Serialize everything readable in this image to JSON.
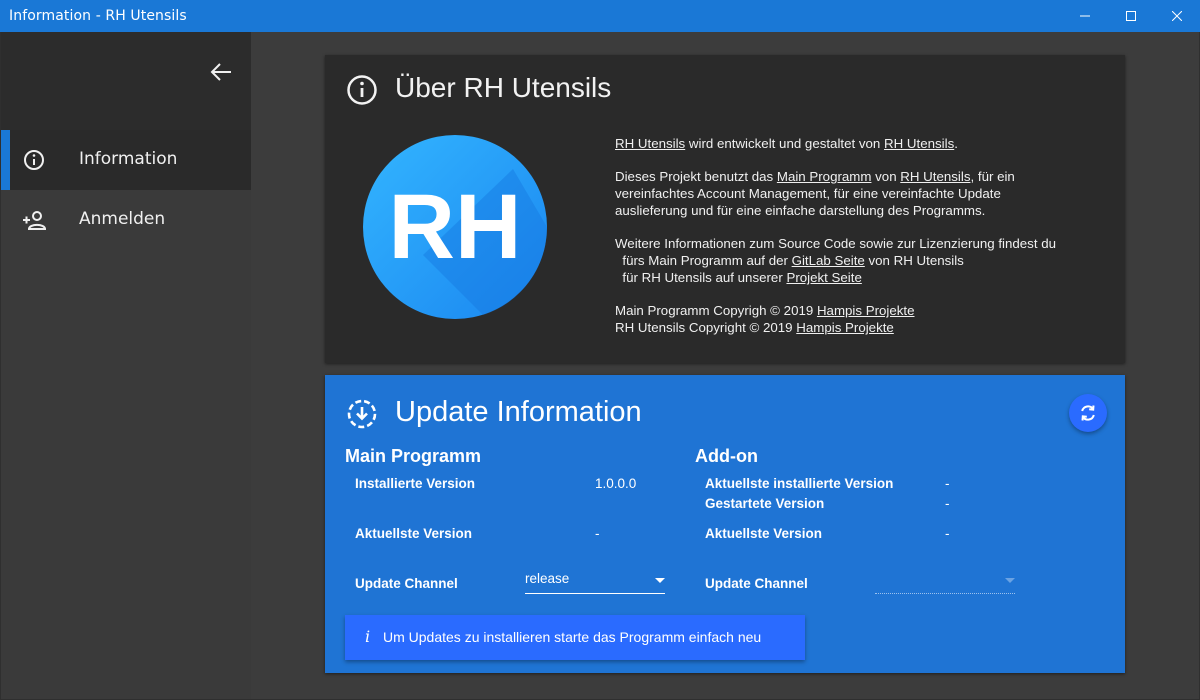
{
  "window": {
    "title": "Information - RH Utensils"
  },
  "sidebar": {
    "items": [
      {
        "label": "Information",
        "icon": "info-icon",
        "selected": true
      },
      {
        "label": "Anmelden",
        "icon": "add-person-icon",
        "selected": false
      }
    ]
  },
  "about": {
    "title": "Über RH Utensils",
    "logo_text": "RH",
    "line1": {
      "link": "RH Utensils",
      "text": " wird entwickelt und gestaltet von ",
      "link2": "RH Utensils",
      "end": "."
    },
    "para2": {
      "t1": "Dieses Projekt benutzt das ",
      "link1": "Main Programm",
      "t2": " von ",
      "link2": "RH Utensils",
      "t3": ", für ein",
      "t4": "vereinfachtes Account Management, für eine vereinfachte Update",
      "t5": "auslieferung und für eine einfache darstellung des Programms."
    },
    "para3": {
      "t1": "Weitere Informationen zum Source Code sowie zur Lizenzierung findest du",
      "t2": "  fürs Main Programm auf der ",
      "link1": "GitLab Seite",
      "t3": " von RH Utensils",
      "t4": "  für RH Utensils auf unserer ",
      "link2": "Projekt Seite"
    },
    "copyright": {
      "c1": "Main Programm Copyrigh © 2019 ",
      "c1_link": "Hampis Projekte",
      "c2": "RH Utensils Copyright © 2019 ",
      "c2_link": "Hampis Projekte"
    }
  },
  "update": {
    "title": "Update Information",
    "main": {
      "heading": "Main Programm",
      "installed_label": "Installierte Version",
      "installed_value": "1.0.0.0",
      "latest_label": "Aktuellste Version",
      "latest_value": "-",
      "channel_label": "Update Channel",
      "channel_value": "release"
    },
    "addon": {
      "heading": "Add-on",
      "installed_label": "Aktuellste installierte Version",
      "installed_value": "-",
      "started_label": "Gestartete Version",
      "started_value": "-",
      "latest_label": "Aktuellste Version",
      "latest_value": "-",
      "channel_label": "Update Channel",
      "channel_value": ""
    },
    "banner": {
      "icon": "i",
      "text": "Um Updates zu installieren starte das Programm einfach neu"
    }
  },
  "colors": {
    "accent": "#1a78d6",
    "card_blue": "#1f74d4",
    "button_blue": "#2a6bff"
  }
}
